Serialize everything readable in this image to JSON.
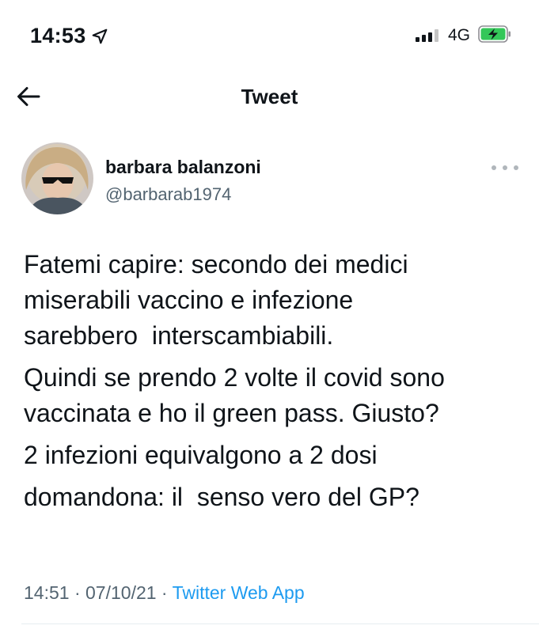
{
  "status_bar": {
    "time": "14:53",
    "location_icon": "location-arrow-icon",
    "network": "4G",
    "signal_icon": "cell-signal-icon",
    "battery_icon": "battery-charging-icon",
    "battery_color": "#34c759"
  },
  "header": {
    "back_icon": "arrow-left-icon",
    "title": "Tweet"
  },
  "tweet": {
    "author_name": "barbara balanzoni",
    "author_handle": "@barbarab1974",
    "more_icon": "more-horizontal-icon",
    "paragraphs": [
      "Fatemi capire: secondo dei medici\nmiserabili vaccino e infezione\nsarebbero  interscambiabili.",
      "Quindi se prendo 2 volte il covid sono\nvaccinata e ho il green pass. Giusto?",
      "2 infezioni equivalgono a 2 dosi",
      "domandona: il  senso vero del GP?"
    ],
    "time": "14:51",
    "date": "07/10/21",
    "separator": " · ",
    "source": "Twitter Web App"
  },
  "colors": {
    "text": "#0f1419",
    "secondary": "#536471",
    "link": "#1d9bf0"
  }
}
